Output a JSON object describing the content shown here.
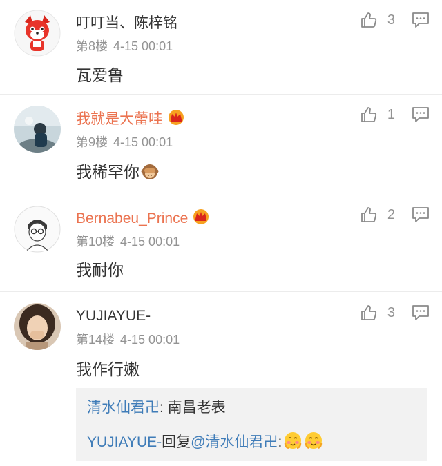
{
  "comments": [
    {
      "username": "叮叮当、陈梓铭",
      "floor": "第8楼",
      "time": "4-15 00:01",
      "text": "瓦爱鲁",
      "likes": "3",
      "vip": false,
      "avatar_icon": "red-fox-cartoon-avatar"
    },
    {
      "username": "我就是大蕾哇",
      "floor": "第9楼",
      "time": "4-15 00:01",
      "text": "我稀罕你",
      "text_emoji": "see-no-evil-monkey",
      "likes": "1",
      "vip": true,
      "avatar_icon": "person-photo-avatar"
    },
    {
      "username": "Bernabeu_Prince",
      "floor": "第10楼",
      "time": "4-15 00:01",
      "text": "我耐你",
      "likes": "2",
      "vip": true,
      "avatar_icon": "sketch-boy-avatar"
    },
    {
      "username": "YUJIAYUE-",
      "floor": "第14楼",
      "time": "4-15 00:01",
      "text": "我作行嫩",
      "likes": "3",
      "vip": false,
      "avatar_icon": "girl-photo-avatar"
    }
  ],
  "replies": [
    {
      "author": "清水仙君卍",
      "separator": ":",
      "text": " 南昌老表"
    },
    {
      "author": "YUJIAYUE-",
      "action": "回复",
      "mention": "@清水仙君卍",
      "separator": ":",
      "emojis": [
        "blushing-face",
        "blushing-face"
      ]
    }
  ],
  "colors": {
    "vip_name": "#eb7350",
    "link": "#3f7cb8",
    "meta": "#939393",
    "reply_bg": "#f2f2f2"
  }
}
